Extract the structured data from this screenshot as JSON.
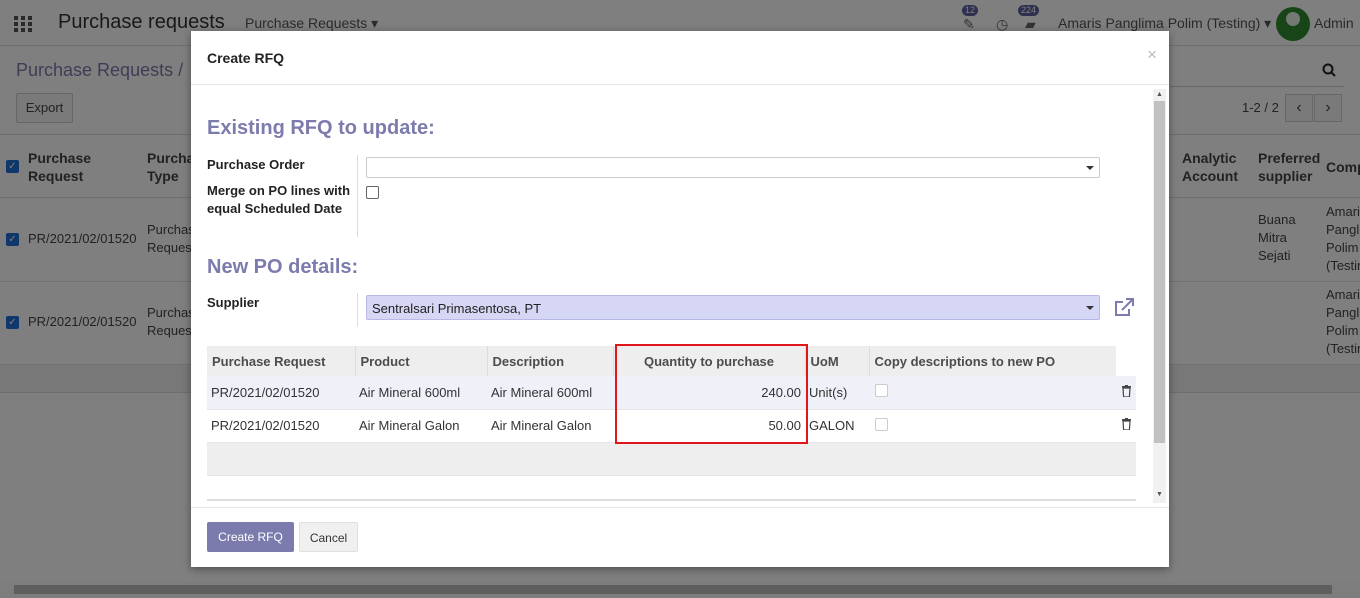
{
  "topnav": {
    "app_title": "Purchase requests",
    "menu_label": "Purchase Requests",
    "activity_badge": "12",
    "messages_badge": "224",
    "user_name": "Amaris Panglima Polim (Testing)",
    "admin_label": "Admin"
  },
  "control_panel": {
    "breadcrumb": "Purchase Requests /",
    "export_label": "Export",
    "pager": "1-2 / 2"
  },
  "background_table": {
    "headers": {
      "purchase_request": "Purchase Request",
      "purchase_type": "Purcha Type",
      "analytic_account": "Analytic Account",
      "preferred_supplier": "Preferred supplier",
      "company": "Comp"
    },
    "rows": [
      {
        "request": "PR/2021/02/01520",
        "type": "Purchas Reques",
        "supplier": "Buana Mitra Sejati",
        "company": "Amari Pangl Polim (Testin"
      },
      {
        "request": "PR/2021/02/01520",
        "type": "Purchas Reques",
        "supplier": "",
        "company": "Amari Pangl Polim (Testin"
      }
    ]
  },
  "modal": {
    "title": "Create RFQ",
    "close": "×",
    "existing_section_title": "Existing RFQ to update:",
    "purchase_order_label": "Purchase Order",
    "purchase_order_value": "",
    "merge_label": "Merge on PO lines with equal Scheduled Date",
    "new_section_title": "New PO details:",
    "supplier_label": "Supplier",
    "supplier_value": "Sentralsari Primasentosa, PT",
    "table": {
      "headers": {
        "purchase_request": "Purchase Request",
        "product": "Product",
        "description": "Description",
        "quantity": "Quantity to purchase",
        "uom": "UoM",
        "copy_desc": "Copy descriptions to new PO"
      },
      "rows": [
        {
          "purchase_request": "PR/2021/02/01520",
          "product": "Air Mineral 600ml",
          "description": "Air Mineral 600ml",
          "quantity": "240.00",
          "uom": "Unit(s)"
        },
        {
          "purchase_request": "PR/2021/02/01520",
          "product": "Air Mineral Galon",
          "description": "Air Mineral Galon",
          "quantity": "50.00",
          "uom": "GALON"
        }
      ]
    },
    "create_label": "Create RFQ",
    "cancel_label": "Cancel"
  }
}
